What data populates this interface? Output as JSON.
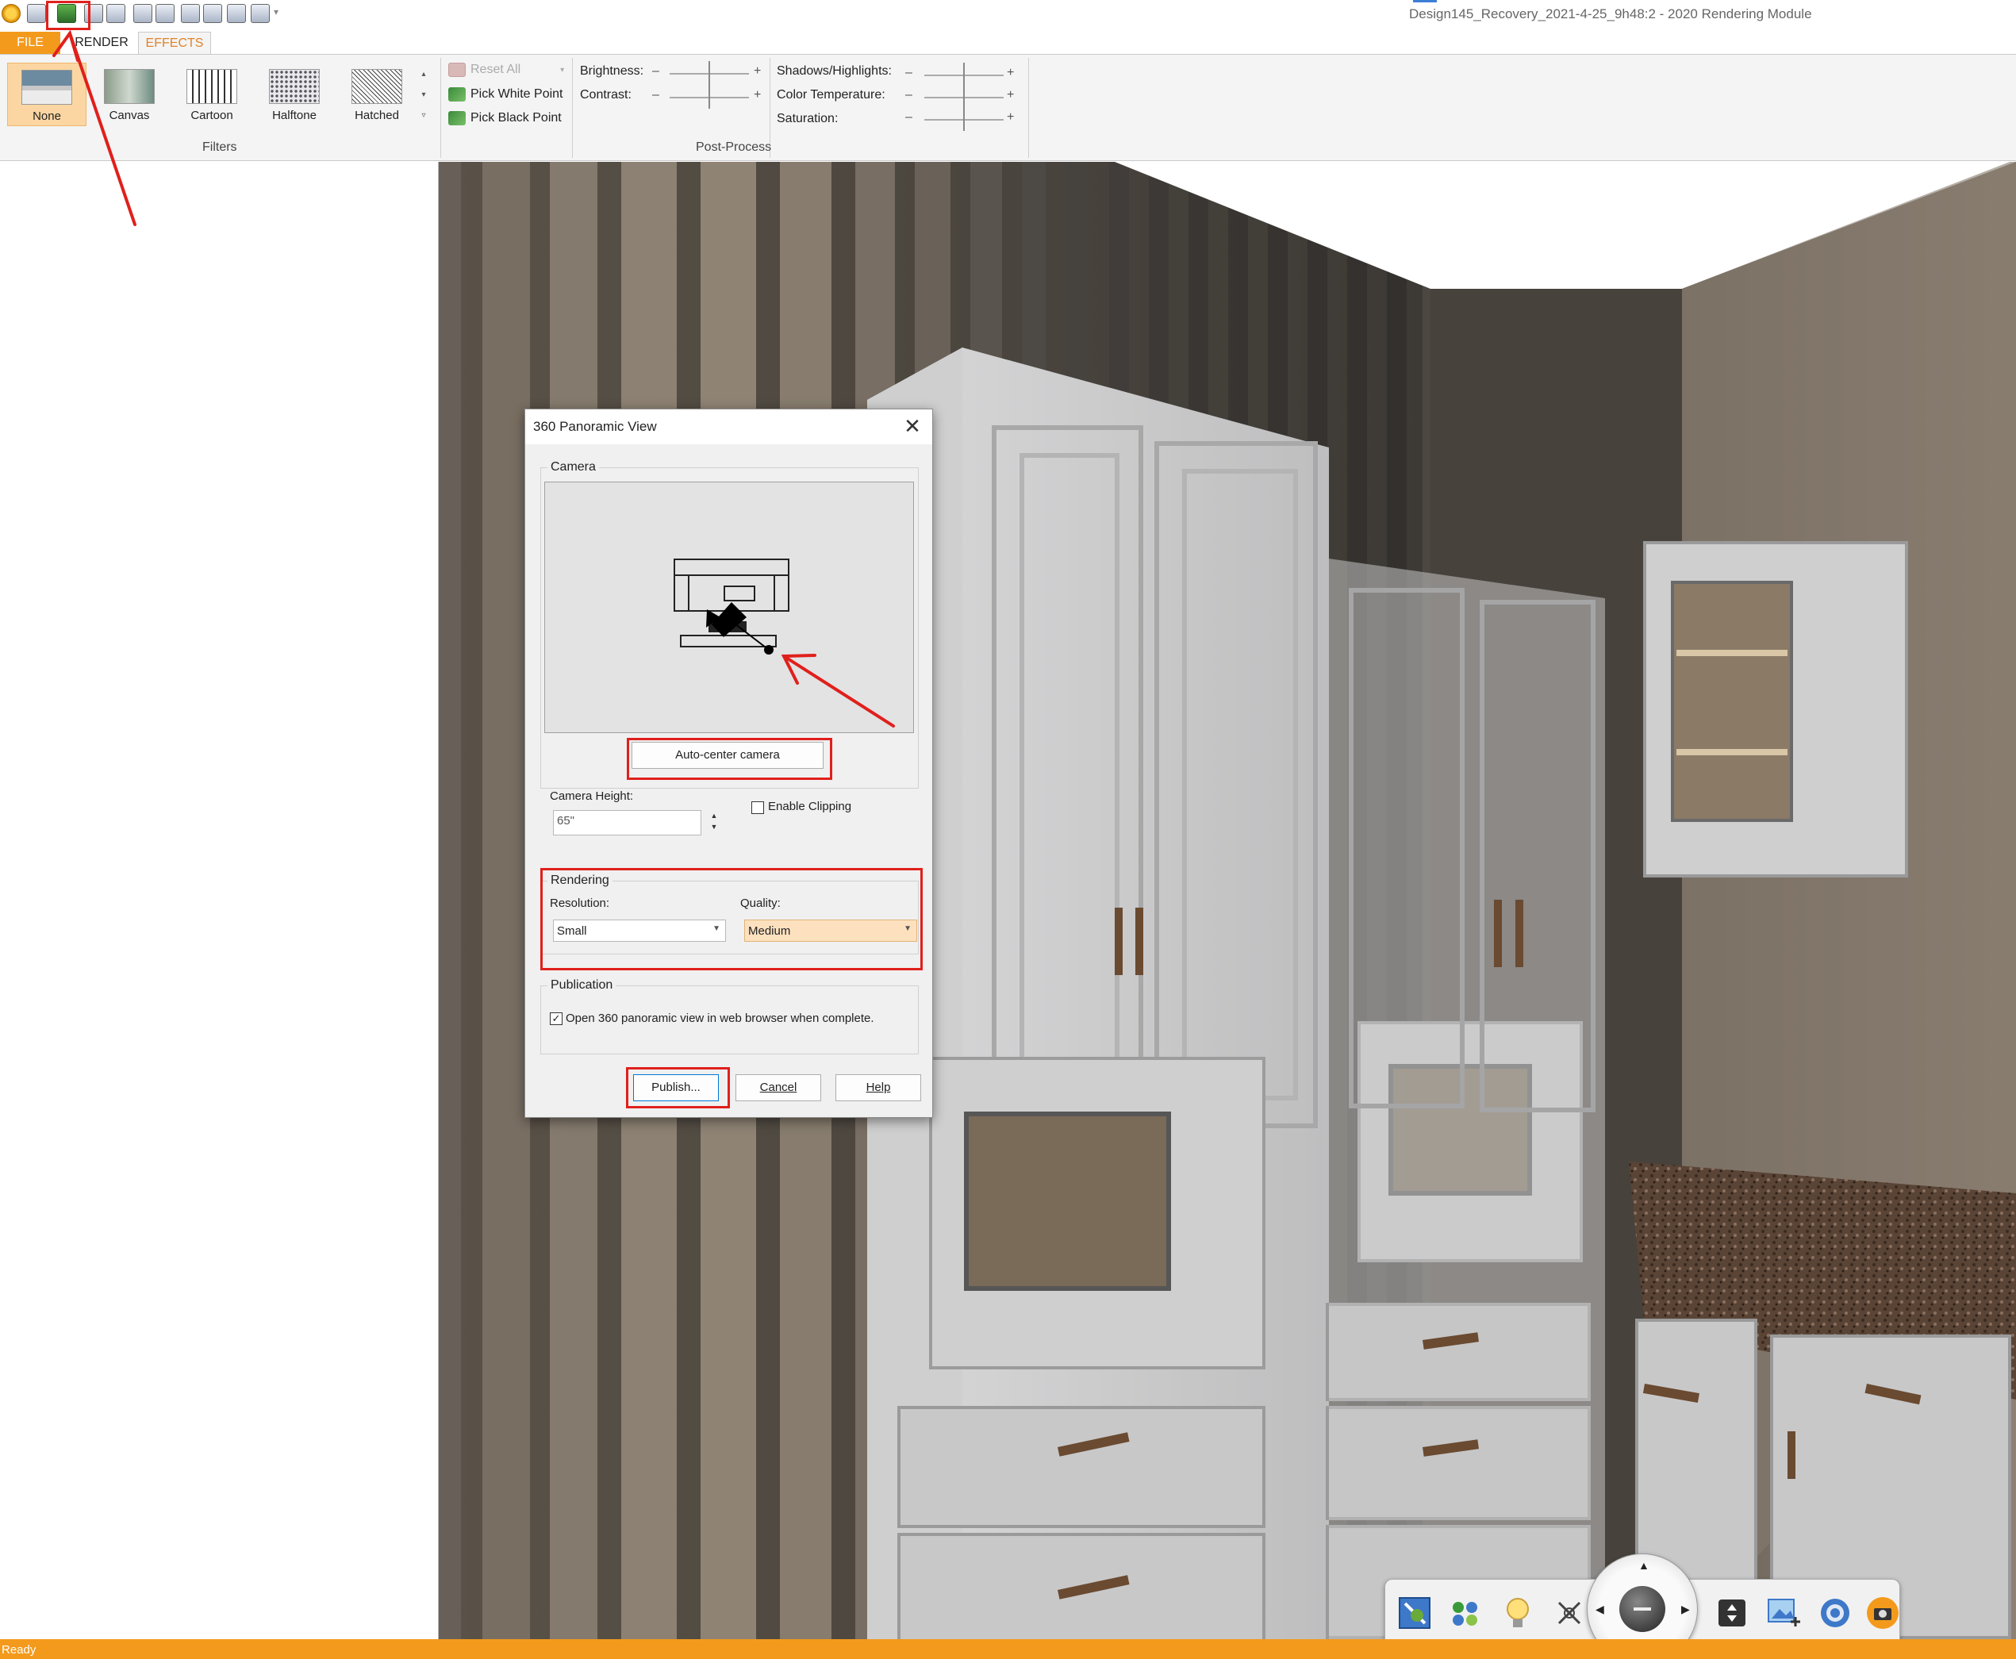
{
  "window": {
    "title": "Design145_Recovery_2021-4-25_9h48:2 - 2020 Rendering Module",
    "quick_access_icons": [
      "app-icon",
      "save-icon",
      "panoramic-icon",
      "print-icon",
      "print-preview-icon",
      "export-icon",
      "page-icon",
      "copy-icon",
      "paste-icon",
      "camera-icon",
      "help-icon"
    ]
  },
  "ribbon": {
    "tabs": [
      "FILE",
      "RENDER",
      "EFFECTS"
    ],
    "active_tab": "EFFECTS",
    "filters": {
      "items": [
        {
          "label": "None",
          "selected": true
        },
        {
          "label": "Canvas",
          "selected": false
        },
        {
          "label": "Cartoon",
          "selected": false
        },
        {
          "label": "Halftone",
          "selected": false
        },
        {
          "label": "Hatched",
          "selected": false
        }
      ],
      "group_label": "Filters"
    },
    "post_process": {
      "reset_all": "Reset All",
      "pick_white_point": "Pick White Point",
      "pick_black_point": "Pick Black Point",
      "brightness": "Brightness:",
      "contrast": "Contrast:",
      "shadows_highlights": "Shadows/Highlights:",
      "color_temperature": "Color Temperature:",
      "saturation": "Saturation:",
      "minus": "–",
      "plus": "+",
      "group_label": "Post-Process"
    }
  },
  "dialog": {
    "title": "360 Panoramic View",
    "camera_group": "Camera",
    "auto_center": "Auto-center camera",
    "camera_height_label": "Camera Height:",
    "camera_height_value": "65\"",
    "enable_clipping": "Enable Clipping",
    "enable_clipping_checked": false,
    "rendering_group": "Rendering",
    "resolution_label": "Resolution:",
    "resolution_value": "Small",
    "quality_label": "Quality:",
    "quality_value": "Medium",
    "publication_group": "Publication",
    "open_browser": "Open 360 panoramic view in web browser when complete.",
    "open_browser_checked": true,
    "publish": "Publish...",
    "cancel": "Cancel",
    "help": "Help"
  },
  "navigation_toolbar": {
    "buttons": [
      "zoom-extents-icon",
      "materials-icon",
      "lighting-icon",
      "orbit-icon",
      "fit-view-icon",
      "image-export-icon",
      "settings-icon",
      "camera-snapshot-icon"
    ]
  },
  "status": {
    "text": "Ready"
  },
  "colors": {
    "accent_orange": "#f39a1c",
    "annotation_red": "#e0201c",
    "selection_highlight": "#fbd6a2"
  }
}
